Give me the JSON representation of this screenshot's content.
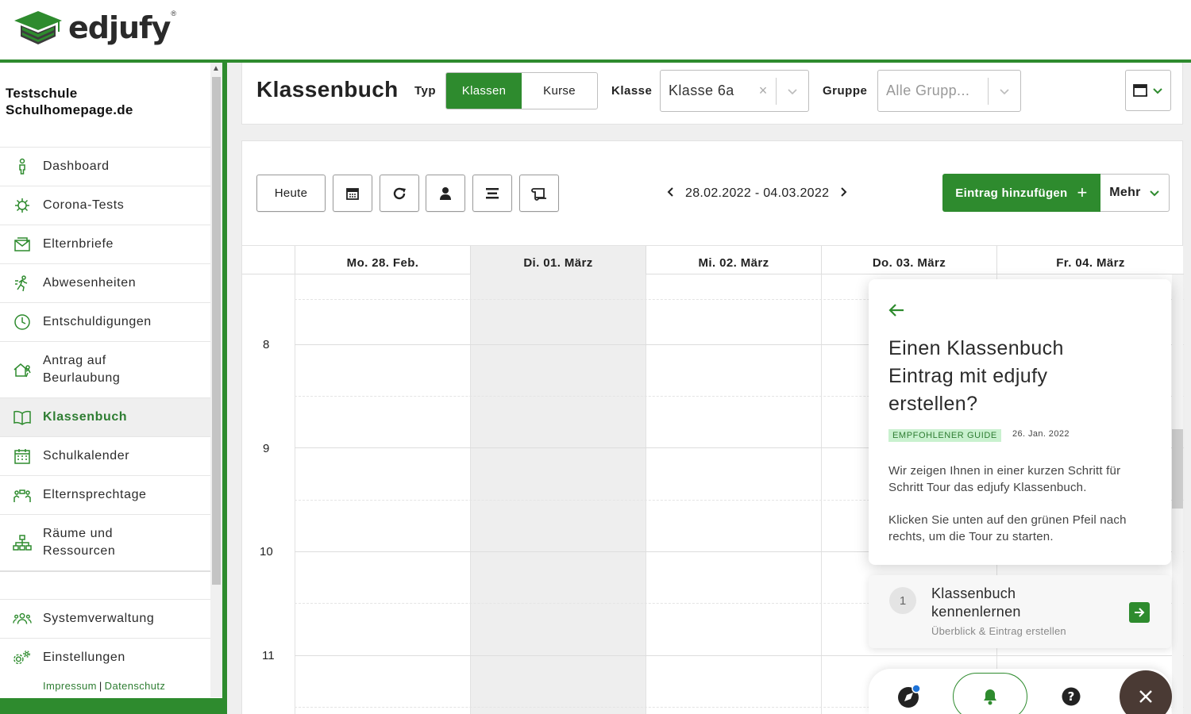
{
  "app": {
    "logo_text": "edjufy",
    "logo_reg": "®"
  },
  "sidebar": {
    "school_line1": "Testschule",
    "school_line2": "Schulhomepage.de",
    "items": [
      {
        "label": "Dashboard",
        "icon": "person-icon"
      },
      {
        "label": "Corona-Tests",
        "icon": "virus-icon"
      },
      {
        "label": "Elternbriefe",
        "icon": "envelope-icon"
      },
      {
        "label": "Abwesenheiten",
        "icon": "running-person-icon"
      },
      {
        "label": "Entschuldigungen",
        "icon": "clock-icon"
      },
      {
        "label": "Antrag auf\nBeurlaubung",
        "icon": "house-travel-icon"
      },
      {
        "label": "Klassenbuch",
        "icon": "book-icon"
      },
      {
        "label": "Schulkalender",
        "icon": "calendar-icon"
      },
      {
        "label": "Elternsprechtage",
        "icon": "people-talk-icon"
      },
      {
        "label": "Räume und\nRessourcen",
        "icon": "hierarchy-icon"
      },
      {
        "label": "Systemverwaltung",
        "icon": "users-icon"
      },
      {
        "label": "Einstellungen",
        "icon": "gears-icon"
      }
    ],
    "footer_impressum": "Impressum",
    "footer_sep": "|",
    "footer_datenschutz": "Datenschutz"
  },
  "header": {
    "title": "Klassenbuch",
    "typ_label": "Typ",
    "typ_options": [
      "Klassen",
      "Kurse"
    ],
    "typ_selected": "Klassen",
    "klasse_label": "Klasse",
    "klasse_value": "Klasse 6a",
    "gruppe_label": "Gruppe",
    "gruppe_placeholder": "Alle Grupp..."
  },
  "toolbar": {
    "today_label": "Heute",
    "date_range": "28.02.2022 - 04.03.2022",
    "add_label": "Eintrag hinzufügen",
    "more_label": "Mehr"
  },
  "calendar": {
    "days": [
      "Mo. 28. Feb.",
      "Di. 01. März",
      "Mi. 02. März",
      "Do. 03. März",
      "Fr. 04. März"
    ],
    "hours": [
      "8",
      "9",
      "10",
      "11"
    ]
  },
  "guide": {
    "title": "Einen Klassenbuch Eintrag mit edjufy erstellen?",
    "badge": "EMPFOHLENER GUIDE",
    "date": "26. Jan. 2022",
    "text1": "Wir zeigen Ihnen in einer kurzen Schritt für Schritt Tour das edjufy Klassenbuch.",
    "text2": "Klicken Sie unten auf den grünen Pfeil nach rechts, um die Tour zu starten.",
    "step_number": "1",
    "step_title": "Klassenbuch\nkennenlernen",
    "step_subtitle": "Überblick & Eintrag erstellen"
  },
  "colors": {
    "brand_green": "#2e8b2e",
    "active_text": "#2e7d32",
    "badge_bg": "#c9f1cf"
  }
}
